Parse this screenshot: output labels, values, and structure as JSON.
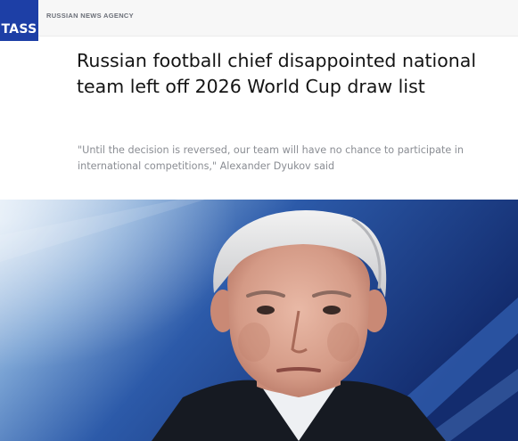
{
  "header": {
    "logo_text": "TASS",
    "agency_name": "RUSSIAN NEWS AGENCY"
  },
  "article": {
    "headline": "Russian football chief disappointed national team left off 2026 World Cup draw list",
    "lede": "\"Until the decision is reversed, our team will have no chance to participate in international competitions,\" Alexander Dyukov said"
  },
  "colors": {
    "brand_blue": "#1d3fa6",
    "headline_text": "#141414",
    "lede_text": "#8a8d93"
  }
}
